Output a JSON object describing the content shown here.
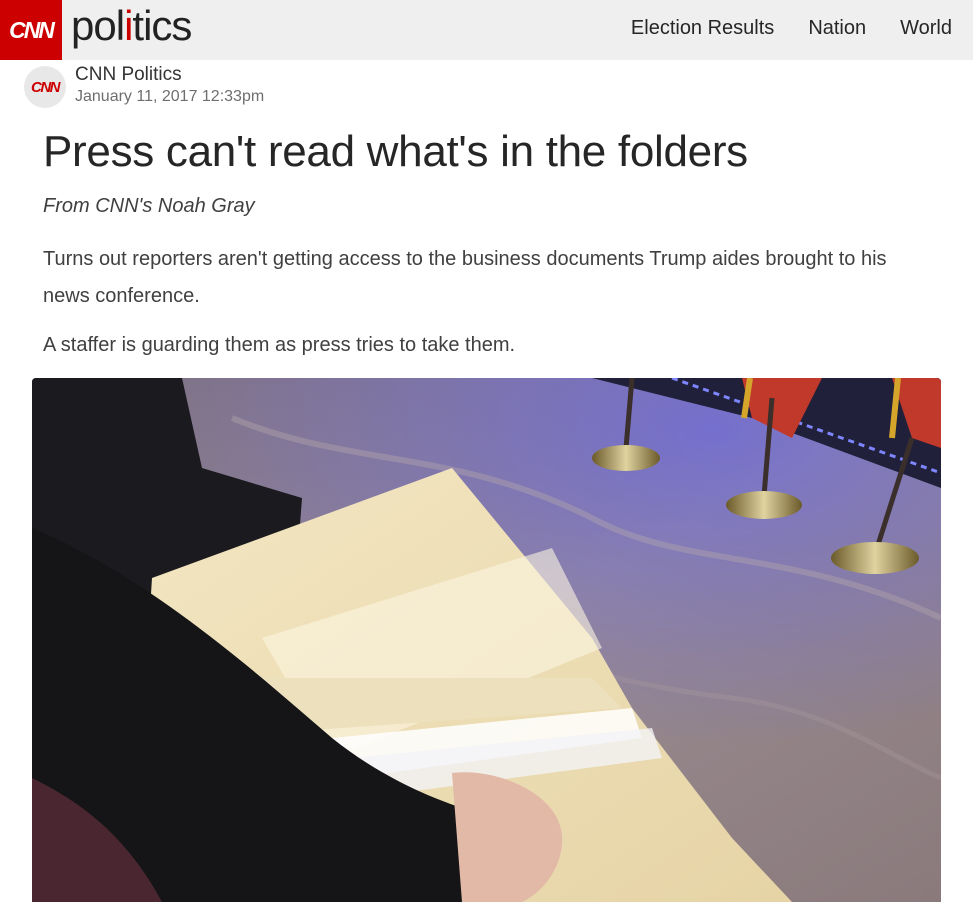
{
  "header": {
    "logo_text": "CNN",
    "section_prefix": "pol",
    "section_accent": "i",
    "section_suffix": "tics",
    "nav": [
      {
        "label": "Election Results"
      },
      {
        "label": "Nation"
      },
      {
        "label": "World"
      }
    ],
    "brand_color": "#cc0000"
  },
  "post": {
    "avatar_text": "CNN",
    "author": "CNN Politics",
    "timestamp": "January 11, 2017 12:33pm",
    "headline": "Press can't read what's in the folders",
    "credit": "From CNN's Noah Gray",
    "paragraphs": [
      "Turns out reporters aren't getting access to the business documents Trump aides brought to his news conference.",
      "A staffer is guarding them as press tries to take them."
    ],
    "photo_icon": "photo-of-folders"
  }
}
